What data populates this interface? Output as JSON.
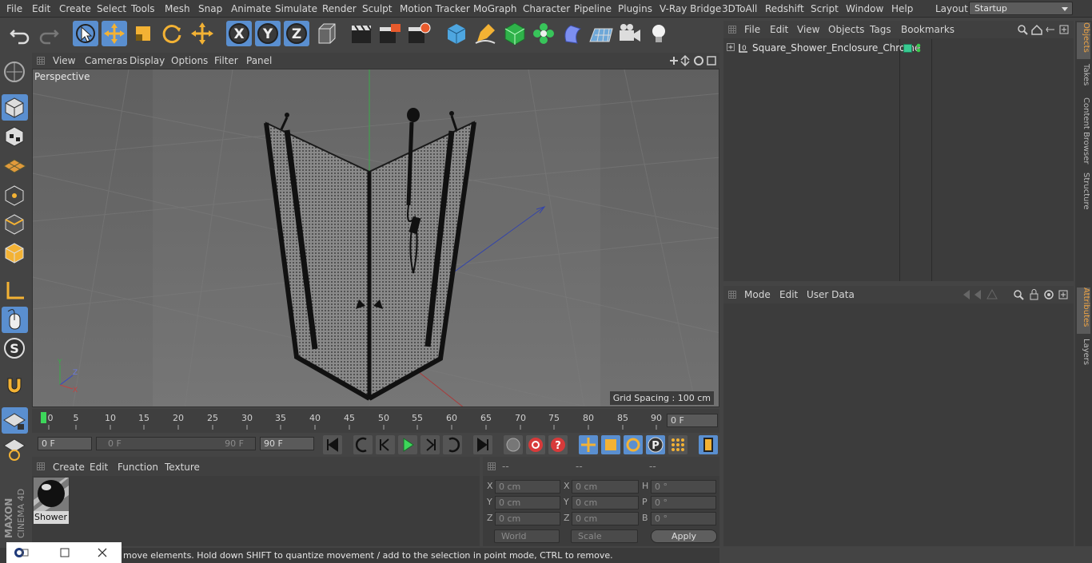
{
  "menu": [
    "File",
    "Edit",
    "Create",
    "Select",
    "Tools",
    "Mesh",
    "Snap",
    "Animate",
    "Simulate",
    "Render",
    "Sculpt",
    "Motion Tracker",
    "MoGraph",
    "Character",
    "Pipeline",
    "Plugins",
    "V-Ray Bridge",
    "3DToAll",
    "Redshift",
    "Script",
    "Window",
    "Help"
  ],
  "layout": {
    "label": "Layout:",
    "value": "Startup"
  },
  "axis_buttons": [
    "X",
    "Y",
    "Z"
  ],
  "viewport": {
    "menu": [
      "View",
      "Cameras",
      "Display",
      "Options",
      "Filter",
      "Panel"
    ],
    "label": "Perspective",
    "grid_spacing": "Grid Spacing : 100 cm"
  },
  "timeline": {
    "ticks": [
      "0",
      "5",
      "10",
      "15",
      "20",
      "25",
      "30",
      "35",
      "40",
      "45",
      "50",
      "55",
      "60",
      "65",
      "70",
      "75",
      "80",
      "85",
      "90"
    ],
    "current_frame": "0 F"
  },
  "transport": {
    "start": "0 F",
    "range_start": "0 F",
    "range_end": "90 F",
    "end": "90 F"
  },
  "material": {
    "menu": [
      "Create",
      "Edit",
      "Function",
      "Texture"
    ],
    "name": "Shower"
  },
  "coords": {
    "headers": [
      "--",
      "--",
      "--"
    ],
    "rows": [
      {
        "a": "X",
        "av": "0 cm",
        "b": "X",
        "bv": "0 cm",
        "c": "H",
        "cv": "0 °"
      },
      {
        "a": "Y",
        "av": "0 cm",
        "b": "Y",
        "bv": "0 cm",
        "c": "P",
        "cv": "0 °"
      },
      {
        "a": "Z",
        "av": "0 cm",
        "b": "Z",
        "bv": "0 cm",
        "c": "B",
        "cv": "0 °"
      }
    ],
    "world": "World",
    "scale": "Scale",
    "apply": "Apply"
  },
  "objects": {
    "menu": [
      "File",
      "Edit",
      "View",
      "Objects",
      "Tags",
      "Bookmarks"
    ],
    "item": "Square_Shower_Enclosure_Chrome"
  },
  "attributes": {
    "menu": [
      "Mode",
      "Edit",
      "User Data"
    ]
  },
  "side_tabs": [
    "Objects",
    "Takes",
    "Content Browser",
    "Structure",
    "Attributes",
    "Layers"
  ],
  "brand": {
    "maxon": "MAXON",
    "product": "CINEMA 4D"
  },
  "status": "move elements. Hold down SHIFT to quantize movement / add to the selection in point mode, CTRL to remove.",
  "colors": {
    "accent": "#5a8fd0",
    "highlight": "#f0a545",
    "play": "#3dd65a"
  }
}
